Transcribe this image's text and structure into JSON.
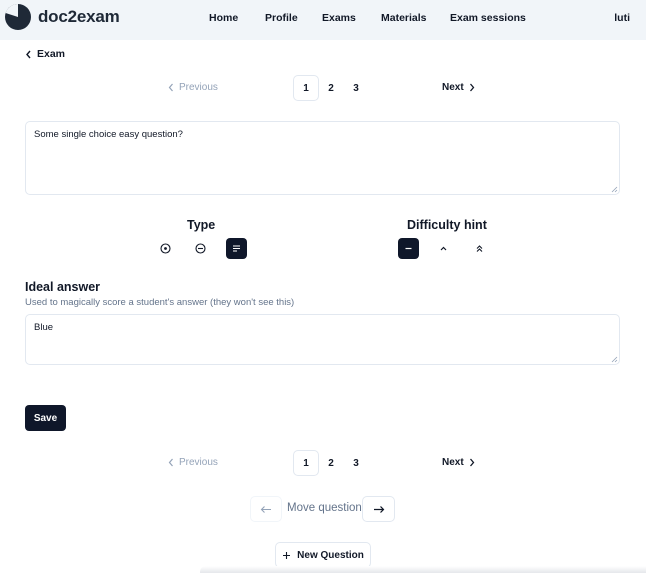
{
  "navbar": {
    "brand": "doc2exam",
    "links": [
      "Home",
      "Profile",
      "Exams",
      "Materials",
      "Exam sessions"
    ],
    "user": "luti"
  },
  "back": {
    "label": "Exam"
  },
  "pagination": {
    "previous_label": "Previous",
    "next_label": "Next",
    "pages": [
      "1",
      "2",
      "3"
    ],
    "current_page": "1"
  },
  "question": {
    "text": "Some single choice easy question?"
  },
  "type_section": {
    "title": "Type",
    "options": [
      "single-choice-icon",
      "multiple-choice-icon",
      "open-text-icon"
    ],
    "selected": "open-text-icon"
  },
  "difficulty_section": {
    "title": "Difficulty hint",
    "options": [
      "minus-icon",
      "chevron-up-icon",
      "chevrons-up-icon"
    ],
    "selected": "minus-icon"
  },
  "ideal_answer": {
    "title": "Ideal answer",
    "subtitle": "Used to magically score a student's answer (they won't see this)",
    "value": "Blue"
  },
  "save_label": "Save",
  "move": {
    "label": "Move question"
  },
  "new_question_label": "New Question",
  "colors": {
    "primary": "#0f172a",
    "navbar_bg": "#f1f5f9",
    "muted": "#64748b",
    "border": "#e2e8f0"
  }
}
